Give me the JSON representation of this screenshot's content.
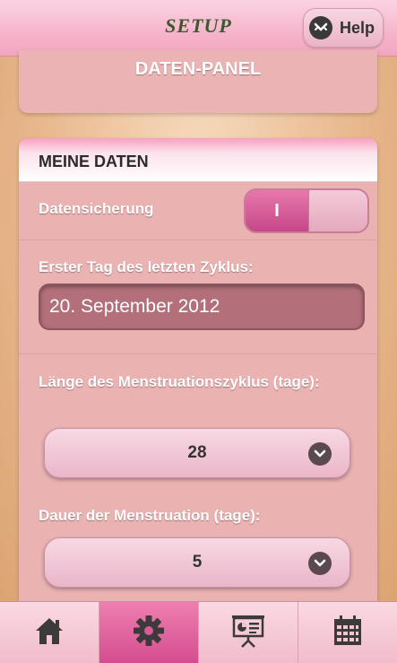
{
  "header": {
    "title": "SETUP",
    "help_label": "Help",
    "help_icon": "help-badge-icon"
  },
  "panel_top": {
    "title": "DATEN-PANEL"
  },
  "my_data": {
    "title": "MEINE DATEN",
    "backup": {
      "label": "Datensicherung",
      "toggle_text": "I",
      "toggle_state": "on"
    },
    "cycle_start": {
      "label": "Erster Tag des letzten Zyklus:",
      "value": "20. September 2012"
    },
    "cycle_length": {
      "label": "Länge des Menstruationszyklus (tage):",
      "value": "28"
    },
    "menstruation_duration": {
      "label": "Dauer der Menstruation (tage):",
      "value": "5"
    }
  },
  "tabs": [
    {
      "icon": "home-icon",
      "active": false
    },
    {
      "icon": "gear-icon",
      "active": true
    },
    {
      "icon": "presentation-icon",
      "active": false
    },
    {
      "icon": "calendar-icon",
      "active": false
    }
  ],
  "colors": {
    "accent": "#d44d8f",
    "header_title": "#3a5a2e",
    "card": "#ebb2b2"
  }
}
